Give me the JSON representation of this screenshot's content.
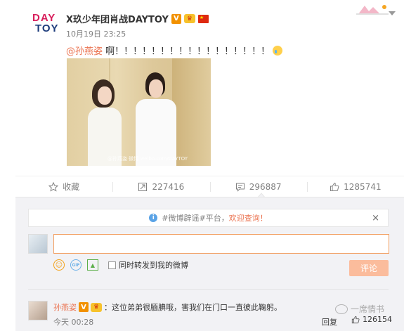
{
  "post": {
    "avatar_logo_line1": "DAY",
    "avatar_logo_line2": "TOY",
    "author": "X玖少年团肖战DAYTOY",
    "verified_badge": "V",
    "crown_badge": "♛",
    "time": "10月19日 23:25",
    "mention": "@孙燕姿",
    "text": " 啊！！！！！！！！！！！！！！！！！",
    "image_watermark": "@孙燕姿 微博 weibo.com/DAYTOY"
  },
  "actions": {
    "favorite_label": "收藏",
    "repost_count": "227416",
    "comment_count": "296887",
    "like_count": "1285741"
  },
  "comment_box": {
    "notice_prefix": "#微博辟谣#平台，",
    "notice_link": "欢迎查询！",
    "notice_close": "×",
    "input_value": "",
    "gif_label": "GIF",
    "repost_label": "同时转发到我的微博",
    "submit_label": "评论"
  },
  "comments": [
    {
      "name": "孙燕姿",
      "verified_badge": "V",
      "crown_badge": "♛",
      "text": "：这位弟弟很腼腆哦，害我们在门口一直彼此鞠躬。",
      "time": "今天 00:28",
      "reply_label": "回复",
      "likes": "126154"
    }
  ],
  "watermark": {
    "text": "一席情书"
  },
  "colors": {
    "accent": "#eb7350",
    "link_gray": "#808080",
    "submit_disabled": "#fbbc9c",
    "verified": "#f29100"
  }
}
